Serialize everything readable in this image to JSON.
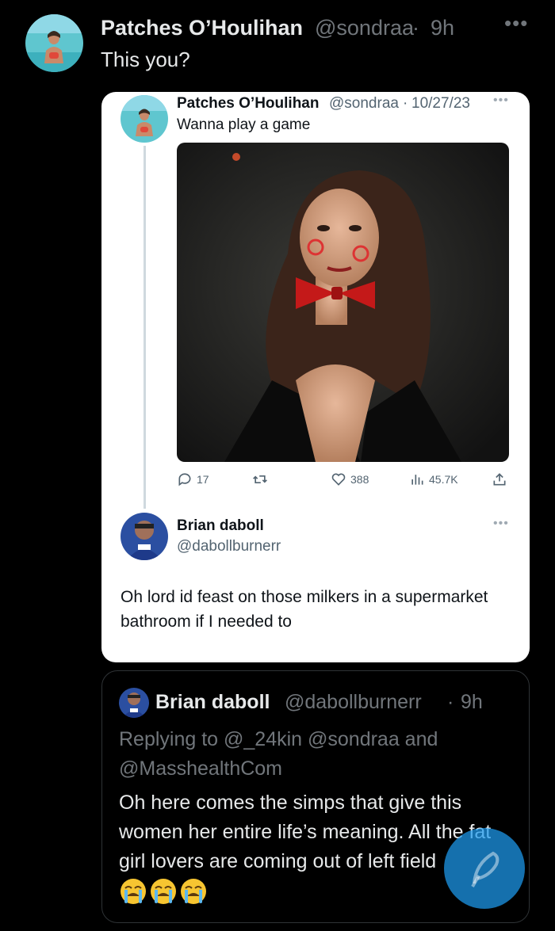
{
  "main": {
    "name": "Patches O’Houlihan",
    "handle": "@sondraa",
    "sep": "·",
    "time": "9h",
    "more": "•••",
    "text": "This you?"
  },
  "screenshot": {
    "name": "Patches O’Houlihan",
    "handle": "@sondraa",
    "sep": "·",
    "date": "10/27/23",
    "more": "•••",
    "text": "Wanna play a game",
    "actions": {
      "replies": "17",
      "likes": "388",
      "views": "45.7K"
    },
    "reply": {
      "name": "Brian daboll",
      "handle": "@dabollburnerr",
      "more": "•••",
      "text": "Oh lord id feast on those milkers in a supermarket bathroom if I needed to"
    }
  },
  "quote": {
    "name": "Brian daboll",
    "handle": "@dabollburnerr",
    "sep": "·",
    "time": "9h",
    "replying": "Replying to @_24kin @sondraa and @MasshealthCom",
    "text": "Oh here comes the simps that give this women her entire life’s meaning. All the fat girl lovers are coming out of left field",
    "emoji_count": 3
  },
  "colors": {
    "background": "#000000",
    "accent": "#1d9bf0",
    "secondary_text": "#71767b"
  }
}
